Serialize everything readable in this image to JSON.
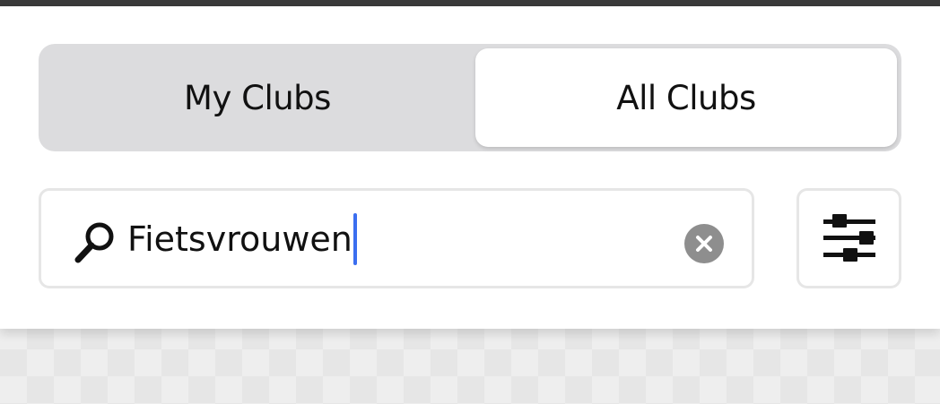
{
  "segmented_control": {
    "options": [
      {
        "label": "My Clubs",
        "selected": false
      },
      {
        "label": "All Clubs",
        "selected": true
      }
    ]
  },
  "search": {
    "value": "Fietsvrouwen",
    "icon": "search-icon",
    "clear_icon": "clear-icon"
  },
  "filter": {
    "icon": "filter-sliders-icon"
  },
  "colors": {
    "caret": "#3b6ef0",
    "segment_track": "#dcdcde",
    "clear_button": "#8e8e8e"
  }
}
